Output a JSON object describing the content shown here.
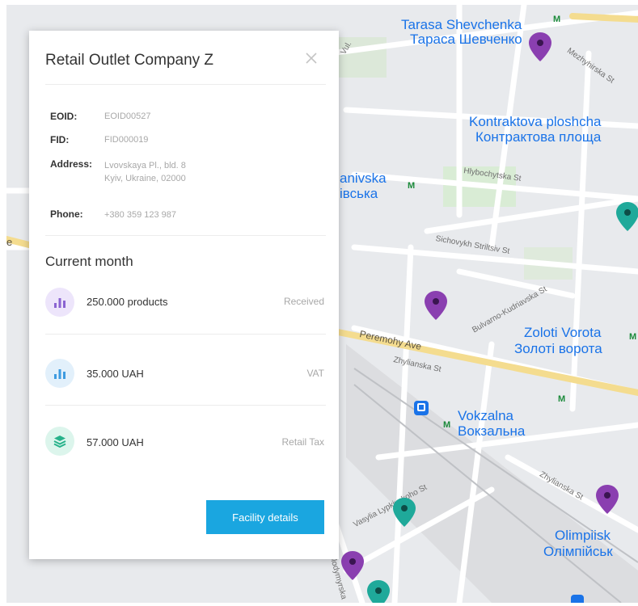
{
  "panel": {
    "title": "Retail Outlet Company Z",
    "info": {
      "eoid_label": "EOID:",
      "eoid_value": "EOID00527",
      "fid_label": "FID:",
      "fid_value": "FID000019",
      "address_label": "Address:",
      "address_line1": "Lvovskaya Pl., bld. 8",
      "address_line2": "Kyiv, Ukraine, 02000",
      "phone_label": "Phone:",
      "phone_value": "+380 359 123 987"
    },
    "section_title": "Current month",
    "stats": [
      {
        "value": "250.000 products",
        "label": "Received",
        "icon": "bar-chart-icon",
        "color": "#8a63d2",
        "bg": "#ede5fb"
      },
      {
        "value": "35.000 UAH",
        "label": "VAT",
        "icon": "bar-chart-icon",
        "color": "#3d9be0",
        "bg": "#e2f0fb"
      },
      {
        "value": "57.000 UAH",
        "label": "Retail Tax",
        "icon": "layers-icon",
        "color": "#27b28a",
        "bg": "#dcf5ec"
      }
    ],
    "details_button": "Facility details"
  },
  "map": {
    "places": {
      "shevchenka_lat": "Tarasa Shevchenka",
      "shevchenka_cyr": "Тараса Шевченко",
      "kontraktova_lat": "Kontraktova ploshcha",
      "kontraktova_cyr": "Контрактова площа",
      "lukianivska_lat": "anivska",
      "lukianivska_cyr": "івська",
      "zoloti_lat": "Zoloti Vorota",
      "zoloti_cyr": "Золоті ворота",
      "vokzalna_lat": "Vokzalna",
      "vokzalna_cyr": "Вокзальна",
      "olimpiiska_lat": "Olimpiisk",
      "olimpiiska_cyr": "Олімпійськ"
    },
    "streets": {
      "peremohy": "Peremohy Ave",
      "hlybochytska": "Hlybochytska St",
      "sichovykh": "Sichovykh Striltsiv St",
      "kudriavska": "Bulvarno-Kudriavska St",
      "zhylianska1": "Zhylianska St",
      "zhylianska2": "Zhylianska St",
      "mezhyhirska": "Mezhyhirska St",
      "lypynskoho": "Vasylia Lypkivskoho St",
      "volodymyrska": "Volodymyrska",
      "edge_top": "Vul.",
      "edge_left": "e"
    },
    "pin_colors": {
      "purple": "#8a3fb0",
      "teal": "#1fa99a"
    }
  }
}
